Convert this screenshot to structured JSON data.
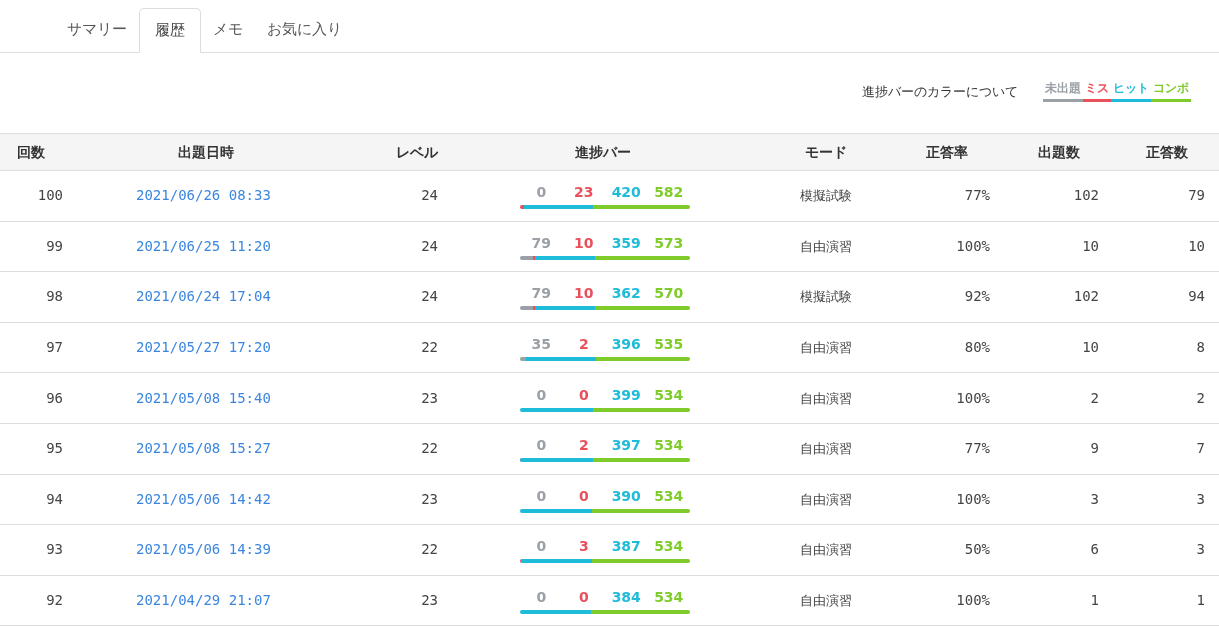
{
  "tabs": [
    {
      "label": "サマリー",
      "selected": false
    },
    {
      "label": "履歴",
      "selected": true
    },
    {
      "label": "メモ",
      "selected": false
    },
    {
      "label": "お気に入り",
      "selected": false
    }
  ],
  "legend": {
    "label": "進捗バーのカラーについて",
    "items": [
      {
        "label": "未出題",
        "color": "#9aa0a6"
      },
      {
        "label": "ミス",
        "color": "#e8505b"
      },
      {
        "label": "ヒット",
        "color": "#1fbcd9"
      },
      {
        "label": "コンボ",
        "color": "#7ecb2a"
      }
    ]
  },
  "table": {
    "columns": [
      "回数",
      "出題日時",
      "レベル",
      "進捗バー",
      "モード",
      "正答率",
      "出題数",
      "正答数"
    ],
    "rows": [
      {
        "count": "100",
        "date": "2021/06/26 08:33",
        "level": "24",
        "counts": [
          {
            "kind": "unanswered",
            "value": "0"
          },
          {
            "kind": "miss",
            "value": "23"
          },
          {
            "kind": "hit",
            "value": "420"
          },
          {
            "kind": "combo",
            "value": "582"
          }
        ],
        "mode": "模擬試験",
        "rate": "77%",
        "questions": "102",
        "correct": "79"
      },
      {
        "count": "99",
        "date": "2021/06/25 11:20",
        "level": "24",
        "counts": [
          {
            "kind": "unanswered",
            "value": "79"
          },
          {
            "kind": "miss",
            "value": "10"
          },
          {
            "kind": "hit",
            "value": "359"
          },
          {
            "kind": "combo",
            "value": "573"
          }
        ],
        "mode": "自由演習",
        "rate": "100%",
        "questions": "10",
        "correct": "10"
      },
      {
        "count": "98",
        "date": "2021/06/24 17:04",
        "level": "24",
        "counts": [
          {
            "kind": "unanswered",
            "value": "79"
          },
          {
            "kind": "miss",
            "value": "10"
          },
          {
            "kind": "hit",
            "value": "362"
          },
          {
            "kind": "combo",
            "value": "570"
          }
        ],
        "mode": "模擬試験",
        "rate": "92%",
        "questions": "102",
        "correct": "94"
      },
      {
        "count": "97",
        "date": "2021/05/27 17:20",
        "level": "22",
        "counts": [
          {
            "kind": "unanswered",
            "value": "35"
          },
          {
            "kind": "miss",
            "value": "2"
          },
          {
            "kind": "hit",
            "value": "396"
          },
          {
            "kind": "combo",
            "value": "535"
          }
        ],
        "mode": "自由演習",
        "rate": "80%",
        "questions": "10",
        "correct": "8"
      },
      {
        "count": "96",
        "date": "2021/05/08 15:40",
        "level": "23",
        "counts": [
          {
            "kind": "unanswered",
            "value": "0"
          },
          {
            "kind": "miss",
            "value": "0"
          },
          {
            "kind": "hit",
            "value": "399"
          },
          {
            "kind": "combo",
            "value": "534"
          }
        ],
        "mode": "自由演習",
        "rate": "100%",
        "questions": "2",
        "correct": "2"
      },
      {
        "count": "95",
        "date": "2021/05/08 15:27",
        "level": "22",
        "counts": [
          {
            "kind": "unanswered",
            "value": "0"
          },
          {
            "kind": "miss",
            "value": "2"
          },
          {
            "kind": "hit",
            "value": "397"
          },
          {
            "kind": "combo",
            "value": "534"
          }
        ],
        "mode": "自由演習",
        "rate": "77%",
        "questions": "9",
        "correct": "7"
      },
      {
        "count": "94",
        "date": "2021/05/06 14:42",
        "level": "23",
        "counts": [
          {
            "kind": "unanswered",
            "value": "0"
          },
          {
            "kind": "miss",
            "value": "0"
          },
          {
            "kind": "hit",
            "value": "390"
          },
          {
            "kind": "combo",
            "value": "534"
          }
        ],
        "mode": "自由演習",
        "rate": "100%",
        "questions": "3",
        "correct": "3"
      },
      {
        "count": "93",
        "date": "2021/05/06 14:39",
        "level": "22",
        "counts": [
          {
            "kind": "unanswered",
            "value": "0"
          },
          {
            "kind": "miss",
            "value": "3"
          },
          {
            "kind": "hit",
            "value": "387"
          },
          {
            "kind": "combo",
            "value": "534"
          }
        ],
        "mode": "自由演習",
        "rate": "50%",
        "questions": "6",
        "correct": "3"
      },
      {
        "count": "92",
        "date": "2021/04/29 21:07",
        "level": "23",
        "counts": [
          {
            "kind": "unanswered",
            "value": "0"
          },
          {
            "kind": "miss",
            "value": "0"
          },
          {
            "kind": "hit",
            "value": "384"
          },
          {
            "kind": "combo",
            "value": "534"
          }
        ],
        "mode": "自由演習",
        "rate": "100%",
        "questions": "1",
        "correct": "1"
      }
    ]
  }
}
